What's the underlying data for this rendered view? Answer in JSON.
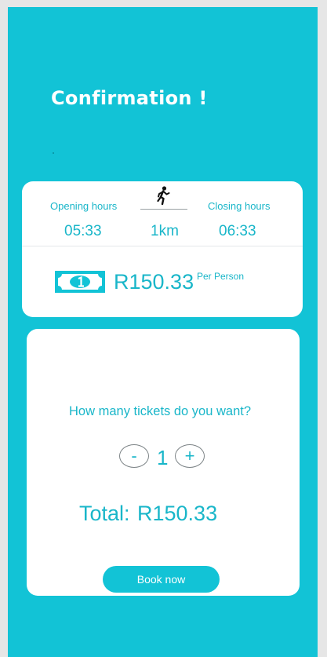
{
  "header": {
    "title": "Confirmation !"
  },
  "info": {
    "opening_label": "Opening hours",
    "opening_time": "05:33",
    "closing_label": "Closing hours",
    "closing_time": "06:33",
    "distance": "1km",
    "distance_icon": "running-person-icon",
    "price": "R150.33",
    "price_unit": "Per Person",
    "price_icon": "banknote-icon"
  },
  "tickets": {
    "question": "How many tickets do you want?",
    "minus_label": "-",
    "plus_label": "+",
    "quantity": "1",
    "total_label": "Total:",
    "total_value": "R150.33",
    "book_label": "Book now"
  },
  "colors": {
    "accent": "#12c3d6",
    "text_accent": "#19b6c9",
    "card": "#ffffff"
  }
}
